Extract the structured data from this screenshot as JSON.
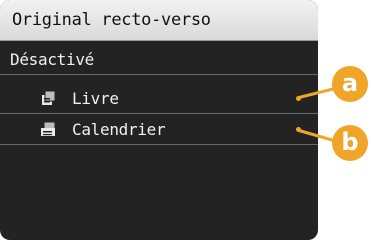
{
  "screen": {
    "title": "Original recto-verso",
    "options_header": "Désactivé",
    "items": [
      {
        "label": "Livre",
        "icon": "book-original-icon"
      },
      {
        "label": "Calendrier",
        "icon": "calendar-original-icon"
      }
    ]
  },
  "callouts": [
    "a",
    "b"
  ],
  "colors": {
    "accent": "#f1a528",
    "screen_bg": "#232323",
    "title_bg": "#e6e6e6",
    "text": "#f0f0f0"
  }
}
